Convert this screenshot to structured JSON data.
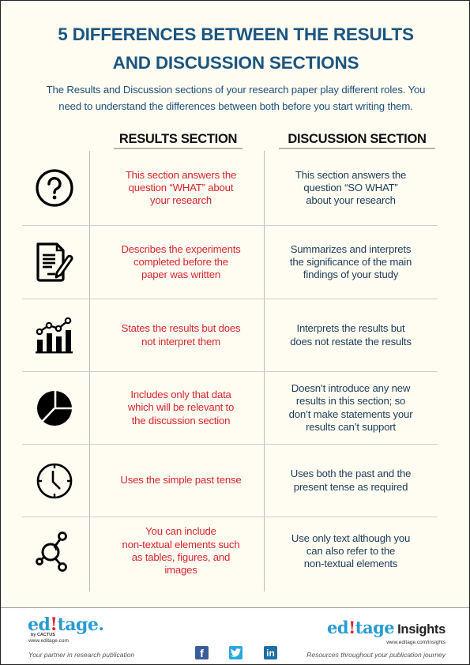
{
  "title": {
    "line1": "5 DIFFERENCES BETWEEN THE RESULTS",
    "line2": "AND DISCUSSION SECTIONS"
  },
  "intro": {
    "line1": "The Results and Discussion sections of your research paper play different roles. You",
    "line2": "need to understand the differences between both before you start writing them."
  },
  "columns": {
    "results": "RESULTS SECTION",
    "discussion": "DISCUSSION SECTION"
  },
  "rows": [
    {
      "icon": "question-circle-icon",
      "results": [
        "This section answers the",
        "question “WHAT” about",
        "your research"
      ],
      "discussion": [
        "This section answers the",
        "question “SO WHAT”",
        "about your research"
      ]
    },
    {
      "icon": "document-pen-icon",
      "results": [
        "Describes the experiments",
        "completed before the",
        "paper was written"
      ],
      "discussion": [
        "Summarizes and interprets",
        "the significance of the main",
        "findings of your study"
      ]
    },
    {
      "icon": "bar-line-chart-icon",
      "results": [
        "States the results but does",
        "not interpret them"
      ],
      "discussion": [
        "Interprets the results but",
        "does not restate the results"
      ]
    },
    {
      "icon": "pie-chart-icon",
      "results": [
        "Includes only that data",
        "which will be relevant to",
        "the discussion section"
      ],
      "discussion": [
        "Doesn’t introduce any new",
        "results in this section; so",
        "don’t make statements your",
        "results can’t support"
      ]
    },
    {
      "icon": "clock-icon",
      "results": [
        "Uses the simple past tense"
      ],
      "discussion": [
        "Uses both the past and the",
        "present tense as required"
      ]
    },
    {
      "icon": "molecule-icon",
      "results": [
        "You can include",
        "non-textual elements such",
        "as tables, figures, and",
        "images"
      ],
      "discussion": [
        "Use only text although you",
        "can also refer to the",
        "non-textual elements"
      ]
    }
  ],
  "footer": {
    "left": {
      "logo_pre": "ed",
      "logo_mark": "!",
      "logo_post": "tage.",
      "byline": "by CACTUS",
      "url": "www.editage.com",
      "tagline": "Your partner in research publication"
    },
    "right": {
      "logo_pre": "ed",
      "logo_mark": "!",
      "logo_post": "tage",
      "logo_suffix": "Insights",
      "url": "www.editage.com/insights",
      "tagline": "Resources throughout your publication journey"
    },
    "social": [
      {
        "name": "facebook",
        "glyph": "f",
        "color": "#3b5c9a"
      },
      {
        "name": "twitter",
        "glyph": "t",
        "color": "#2aa9e0"
      },
      {
        "name": "linkedin",
        "glyph": "in",
        "color": "#1f6ea4"
      }
    ]
  },
  "colors": {
    "title": "#1b5580",
    "results_text": "#d8262f",
    "discussion_text": "#1e3e58",
    "background": "#fffcf2"
  }
}
